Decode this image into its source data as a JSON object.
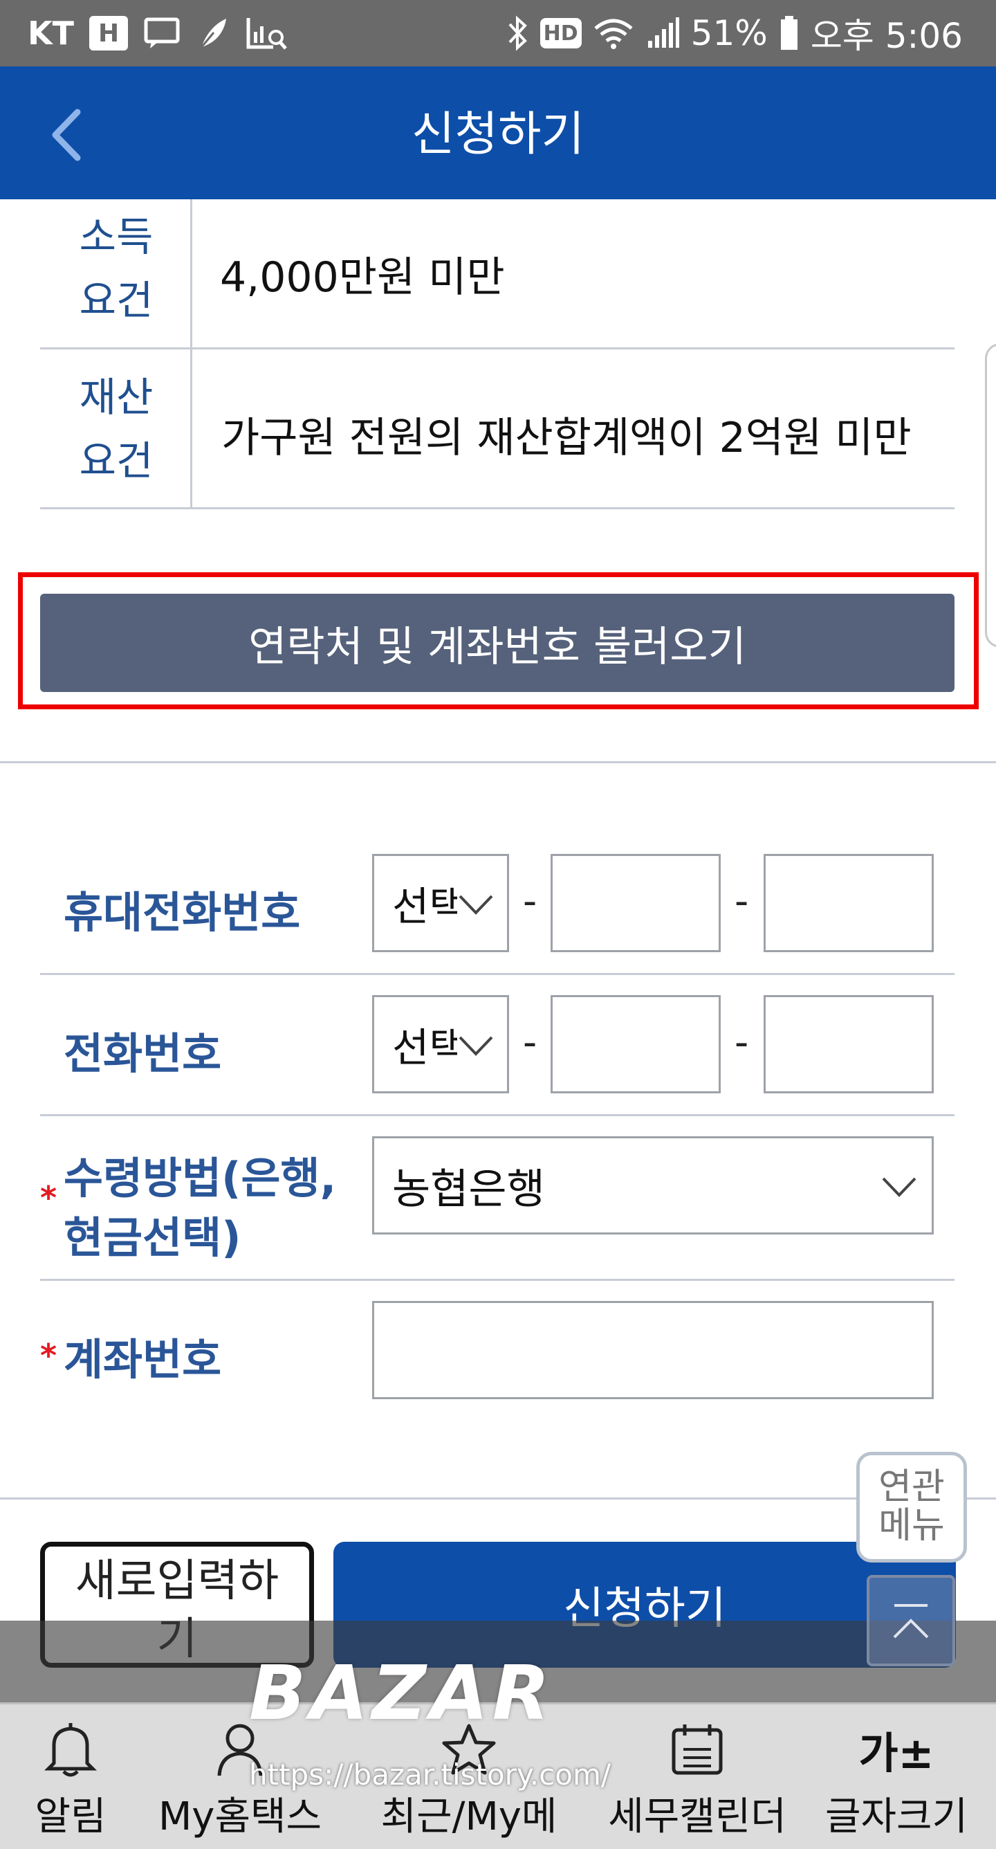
{
  "status_bar": {
    "carrier": "KT",
    "hd": "HD",
    "battery": "51%",
    "time": "오후 5:06"
  },
  "header": {
    "title": "신청하기"
  },
  "requirements": [
    {
      "label_line1": "소득",
      "label_line2": "요건",
      "value": "4,000만원 미만"
    },
    {
      "label_line1": "재산",
      "label_line2": "요건",
      "value": "가구원 전원의 재산합계액이 2억원 미만"
    }
  ],
  "load_button": {
    "label": "연락처 및 계좌번호 불러오기"
  },
  "form": {
    "mobile": {
      "label": "휴대전화번호",
      "select": "선택",
      "separator": "-"
    },
    "phone": {
      "label": "전화번호",
      "select": "선택",
      "separator": "-"
    },
    "receive_method": {
      "required": "*",
      "label_line1": "수령방법(은행,",
      "label_line2": "현금선택)",
      "value": "농협은행"
    },
    "account": {
      "required": "*",
      "label": "계좌번호",
      "value": ""
    }
  },
  "actions": {
    "reset_label_line1": "새로입력하",
    "reset_label_line2": "기",
    "apply_label": "신청하기",
    "related_line1": "연관",
    "related_line2": "메뉴"
  },
  "bottom_nav": [
    {
      "label": "알림",
      "icon": "bell-icon"
    },
    {
      "label": "My홈택스",
      "icon": "person-icon"
    },
    {
      "label": "최근/My메뉴",
      "icon": "star-icon"
    },
    {
      "label": "세무캘린더",
      "icon": "calendar-icon"
    },
    {
      "label": "글자크기",
      "icon": "font-size-icon",
      "glyph": "가±"
    }
  ],
  "watermark": {
    "title": "BAZAR",
    "url": "https://bazar.tistory.com/"
  },
  "colors": {
    "primary": "#0d4ea8",
    "load_button": "#56627b",
    "highlight_frame": "#ee0000",
    "label": "#2a5698",
    "required": "#e31b23"
  }
}
